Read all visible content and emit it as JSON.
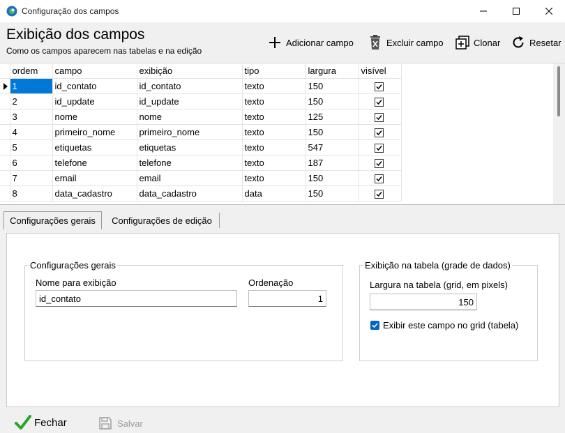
{
  "window": {
    "title": "Configuração dos campos"
  },
  "header": {
    "title": "Exibição dos campos",
    "subtitle": "Como os campos aparecem nas tabelas e na edição"
  },
  "toolbar": {
    "add": "Adicionar campo",
    "delete": "Excluir campo",
    "clone": "Clonar",
    "reset": "Resetar"
  },
  "grid": {
    "columns": [
      "ordem",
      "campo",
      "exibição",
      "tipo",
      "largura",
      "visível"
    ],
    "rows": [
      {
        "ordem": "1",
        "campo": "id_contato",
        "exibicao": "id_contato",
        "tipo": "texto",
        "largura": "150",
        "visivel": true
      },
      {
        "ordem": "2",
        "campo": "id_update",
        "exibicao": "id_update",
        "tipo": "texto",
        "largura": "150",
        "visivel": true
      },
      {
        "ordem": "3",
        "campo": "nome",
        "exibicao": "nome",
        "tipo": "texto",
        "largura": "125",
        "visivel": true
      },
      {
        "ordem": "4",
        "campo": "primeiro_nome",
        "exibicao": "primeiro_nome",
        "tipo": "texto",
        "largura": "150",
        "visivel": true
      },
      {
        "ordem": "5",
        "campo": "etiquetas",
        "exibicao": "etiquetas",
        "tipo": "texto",
        "largura": "547",
        "visivel": true
      },
      {
        "ordem": "6",
        "campo": "telefone",
        "exibicao": "telefone",
        "tipo": "texto",
        "largura": "187",
        "visivel": true
      },
      {
        "ordem": "7",
        "campo": "email",
        "exibicao": "email",
        "tipo": "texto",
        "largura": "150",
        "visivel": true
      },
      {
        "ordem": "8",
        "campo": "data_cadastro",
        "exibicao": "data_cadastro",
        "tipo": "data",
        "largura": "150",
        "visivel": true
      }
    ],
    "selected_row": 0
  },
  "tabs": [
    "Configurações gerais",
    "Configurações de edição"
  ],
  "general": {
    "legend": "Configurações gerais",
    "display_name_label": "Nome para exibição",
    "display_name_value": "id_contato",
    "order_label": "Ordenação",
    "order_value": "1"
  },
  "table_view": {
    "legend": "Exibição na tabela (grade de dados)",
    "width_label": "Largura na tabela (grid, em pixels)",
    "width_value": "150",
    "show_label": "Exibir este campo no grid (tabela)",
    "show_checked": true
  },
  "footer": {
    "close": "Fechar",
    "save": "Salvar"
  },
  "colors": {
    "accent": "#0078d7",
    "check_green": "#2aa52a",
    "disabled": "#9a9a9a"
  }
}
